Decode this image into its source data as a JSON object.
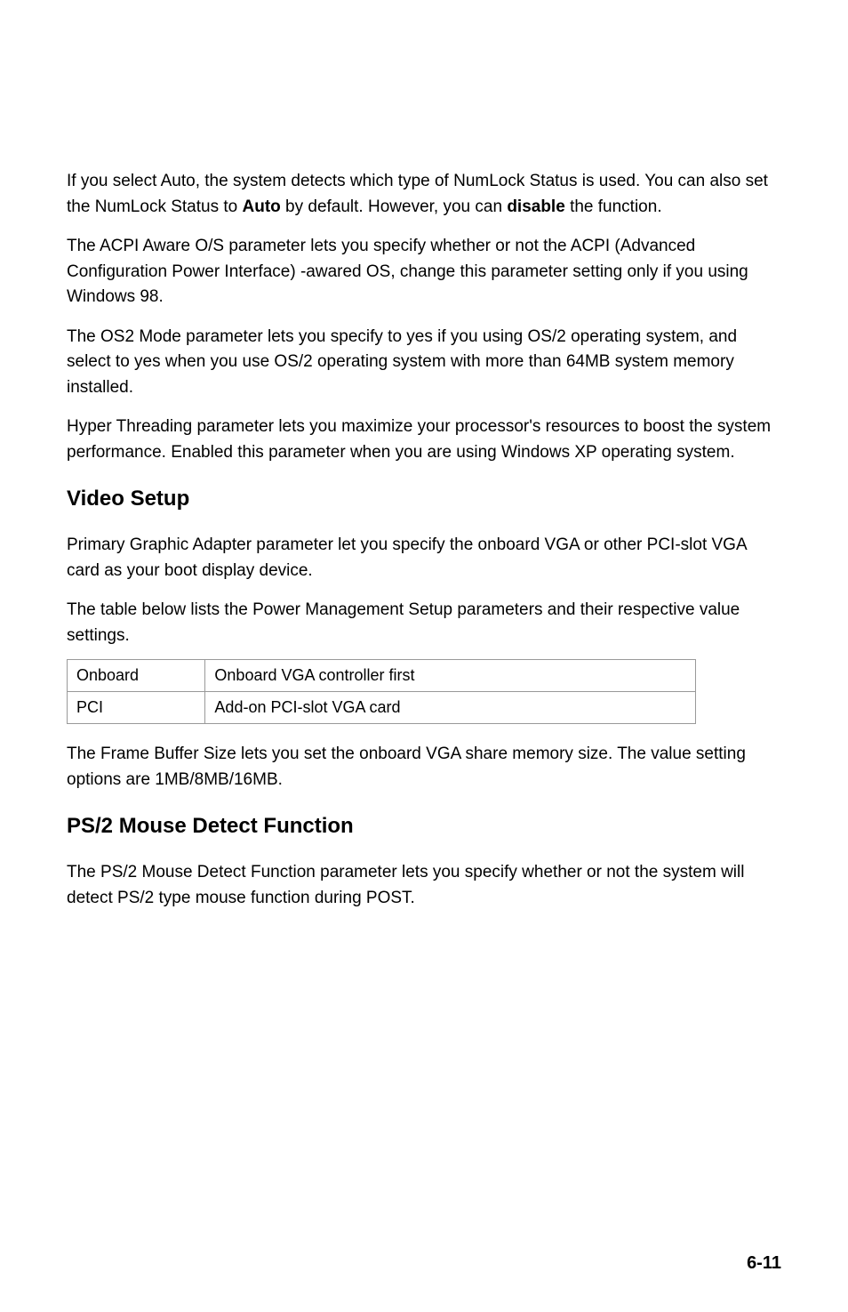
{
  "para1": {
    "prefix": "If you select Auto, the system detects which type of NumLock Status is used. You can also set the NumLock Status to ",
    "bold1": "Auto",
    "mid1": " by default. However, you can ",
    "bold2": "disable",
    "suffix": " the function."
  },
  "para2": "The ACPI Aware O/S parameter lets you specify whether or not the ACPI (Advanced Configuration Power Interface) -awared OS, change this parameter setting only if you using Windows 98.",
  "para3": "The OS2 Mode parameter lets you specify to yes if you using OS/2 operating system, and select to yes when you use OS/2 operating system with more than 64MB system memory installed.",
  "para4": "Hyper Threading parameter lets you maximize your processor's resources to boost the system performance. Enabled this parameter when you are using Windows XP operating system.",
  "heading1": "Video Setup",
  "para5": "Primary Graphic Adapter parameter let you specify the onboard VGA or other PCI-slot VGA card as your boot display device.",
  "para6": "The table below lists the Power Management Setup parameters and their respective value settings.",
  "table": {
    "row1": {
      "c1": "Onboard",
      "c2": "Onboard VGA controller first"
    },
    "row2": {
      "c1": "PCI",
      "c2": "Add-on PCI-slot VGA card"
    }
  },
  "para7": "The Frame Buffer Size lets you set the onboard VGA share memory size. The value setting options are 1MB/8MB/16MB.",
  "heading2": "PS/2 Mouse Detect Function",
  "para8": "The PS/2 Mouse Detect Function parameter lets you specify whether or not the system will detect PS/2 type mouse function during POST.",
  "pageNumber": "6-11"
}
